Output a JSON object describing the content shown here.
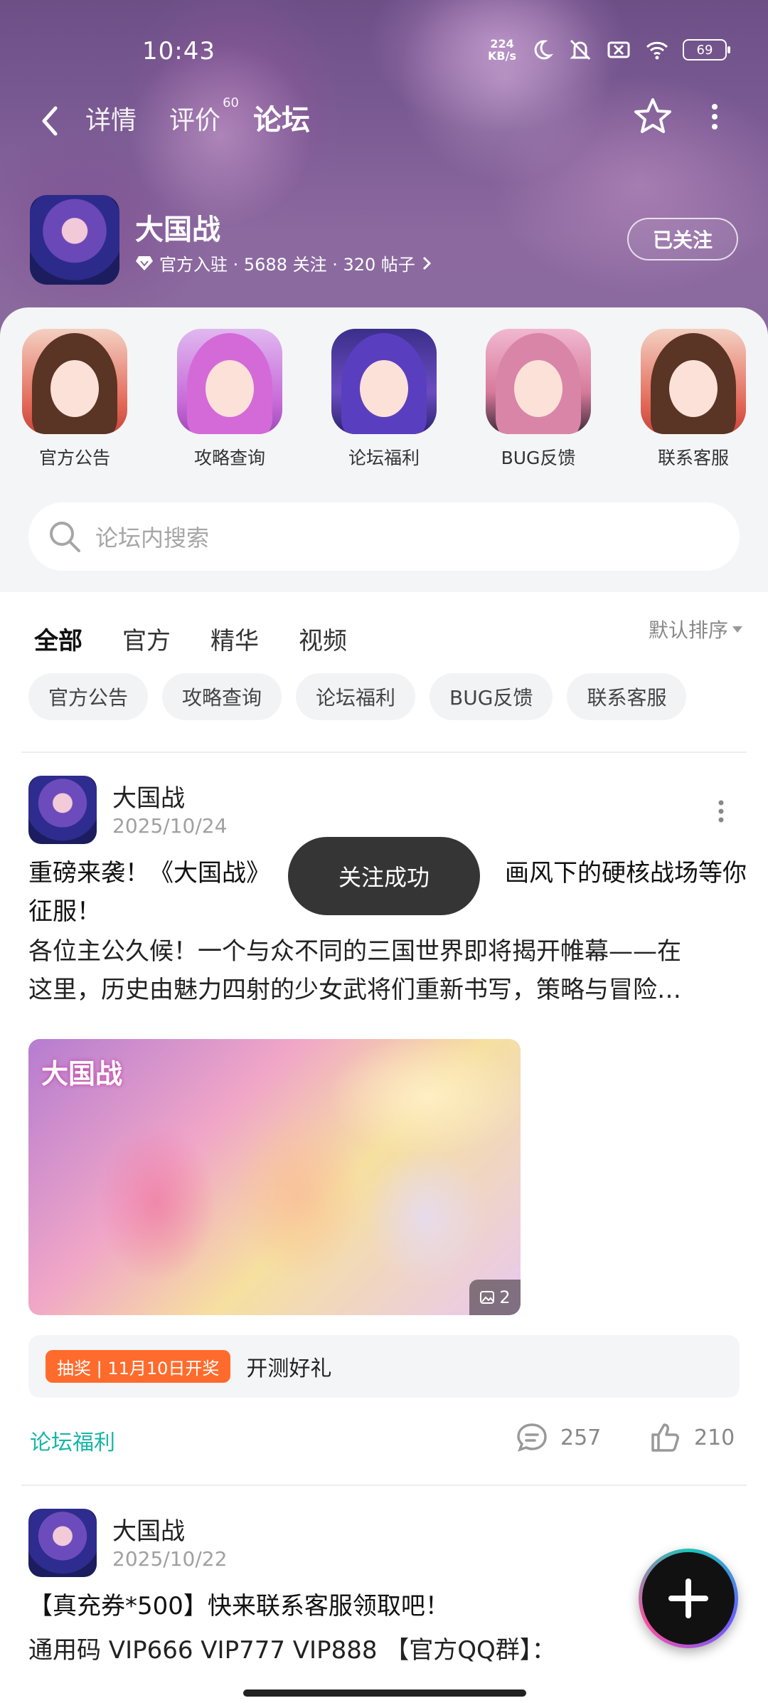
{
  "status_bar": {
    "time": "10:43",
    "net_speed_value": "224",
    "net_speed_unit": "KB/s",
    "battery": "69"
  },
  "nav": {
    "tabs": [
      {
        "label": "详情"
      },
      {
        "label": "评价",
        "badge": "60"
      },
      {
        "label": "论坛"
      }
    ],
    "active_tab": "论坛"
  },
  "forum": {
    "name": "大国战",
    "meta": "官方入驻 · 5688 关注 · 320 帖子",
    "follow_label": "已关注"
  },
  "shortcuts": [
    {
      "label": "官方公告"
    },
    {
      "label": "攻略查询"
    },
    {
      "label": "论坛福利"
    },
    {
      "label": "BUG反馈"
    },
    {
      "label": "联系客服"
    }
  ],
  "search": {
    "placeholder": "论坛内搜索"
  },
  "filter_tabs": [
    "全部",
    "官方",
    "精华",
    "视频"
  ],
  "sort_label": "默认排序",
  "chips": [
    "官方公告",
    "攻略查询",
    "论坛福利",
    "BUG反馈",
    "联系客服"
  ],
  "posts": [
    {
      "author": "大国战",
      "date": "2025/10/24",
      "title_line1": "重磅来袭！《大国战》",
      "title_line1_end": "画风下的硬核战场等你",
      "title_line2": "征服！",
      "body_line1": "各位主公久候！一个与众不同的三国世界即将揭开帷幕——在",
      "body_line2": "这里，历史由魅力四射的少女武将们重新书写，策略与冒险…",
      "image_count": "2",
      "lottery_tag": "抽奖 | 11月10日开奖",
      "lottery_text": "开测好礼",
      "category": "论坛福利",
      "comments": "257",
      "likes": "210"
    },
    {
      "author": "大国战",
      "date": "2025/10/22",
      "title_line1": "【真充券*500】快来联系客服领取吧！",
      "body_line1": "通用码  VIP666  VIP777  VIP888 【官方QQ群】："
    }
  ],
  "toast": "关注成功"
}
